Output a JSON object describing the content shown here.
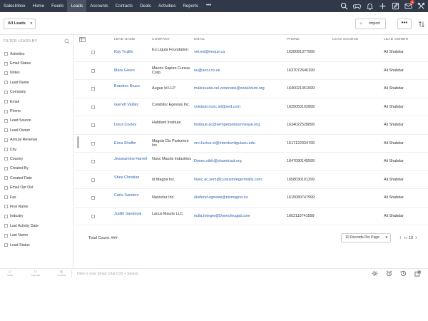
{
  "nav": {
    "items": [
      "SalesInbox",
      "Home",
      "Feeds",
      "Leads",
      "Accounts",
      "Contacts",
      "Deals",
      "Activities",
      "Reports"
    ],
    "active_index": 3,
    "more": "•••",
    "mail_badge": "1",
    "icons": [
      "search-icon",
      "game-controller-icon",
      "bell-icon",
      "add-icon",
      "edit-icon",
      "mail-icon",
      "tools-icon"
    ]
  },
  "toolbar": {
    "view": "All Leads",
    "import_label": "Import",
    "more_label": "•••"
  },
  "filters": {
    "heading": "FILTER LEADS BY",
    "items": [
      "Activities",
      "Email Status",
      "Notes",
      "Lead Name",
      "Company",
      "Email",
      "Phone",
      "Lead Source",
      "Lead Owner",
      "Annual Revenue",
      "City",
      "Country",
      "Created By",
      "Created Date",
      "Email Opt Out",
      "Fax",
      "First Name",
      "Industry",
      "Last Activity Date",
      "Last Name",
      "Lead Status"
    ]
  },
  "table": {
    "columns": {
      "lead_name": "LEAD NAME",
      "company": "COMPANY",
      "email": "EMAIL",
      "phone": "PHONE",
      "lead_source": "LEAD SOURCE",
      "lead_owner": "LEAD OWNER"
    },
    "rows": [
      {
        "name": "Ray Trujillo",
        "company": "Eu Ligula Foundation",
        "email": "vel.est@neque.ca",
        "phone": "1628081377999",
        "source": "",
        "owner": "Ali Shabdar"
      },
      {
        "name": "Mara Green",
        "company": "Mauris Sapien Cursus Corp.",
        "email": "eu@arcu.co.uk",
        "phone": "1637072646199",
        "source": "",
        "owner": "Ali Shabdar"
      },
      {
        "name": "Branden Bruce",
        "company": "Augue Id LLP",
        "email": "malesuada.vel.venenatis@sodalctum.org",
        "phone": "1640021351699",
        "source": "",
        "owner": "Ali Shabdar"
      },
      {
        "name": "Garrett Valdez",
        "company": "Curabitur Egestas Inc.",
        "email": "volutpat.nunc.sit@sed.com",
        "phone": "1625050102899",
        "source": "",
        "owner": "Ali Shabdar"
      },
      {
        "name": "Linus Cooley",
        "company": "Habitant Institute",
        "email": "tristique.ac@semperprebumneque.org",
        "phone": "1634022528899",
        "source": "",
        "owner": "Ali Shabdar"
      },
      {
        "name": "Erica Shaffer",
        "company": "Magnis Dis Parturient Inc.",
        "email": "orci.luctus.et@interdumligulaeu.edu",
        "phone": "1617122034799",
        "source": "",
        "owner": "Ali Shabdar"
      },
      {
        "name": "Jesseamine Harrell",
        "company": "Nunc Mauris Industries",
        "email": "Donec.nibh@pharetraut.org",
        "phone": "1647090145599",
        "source": "",
        "owner": "Ali Shabdar"
      },
      {
        "name": "Shea Christian",
        "company": "Id Magna Inc.",
        "email": "Nunc.ac.sem@cursusIntegermollis.com",
        "phone": "1658030101299",
        "source": "",
        "owner": "Ali Shabdar"
      },
      {
        "name": "Carla Sanders",
        "company": "Nascetur Inc.",
        "email": "eleifend.egestas@nismagna.ca",
        "phone": "1615080747999",
        "source": "",
        "owner": "Ali Shabdar"
      },
      {
        "name": "Judith Sandoval",
        "company": "Lacus Mauris LLC",
        "email": "nulla.Integer@Donecfeugiat.com",
        "phone": "1602110741599",
        "source": "",
        "owner": "Ali Shabdar"
      }
    ],
    "total_label": "Total Count: ###",
    "per_page": "10 Records Per Page",
    "page_current": "1",
    "page_to": "10"
  },
  "bottom": {
    "tabs": [
      "Chats",
      "Channels",
      "Contacts"
    ],
    "smart_command": "Here is your Smart Chat (Ctrl + Space)"
  }
}
